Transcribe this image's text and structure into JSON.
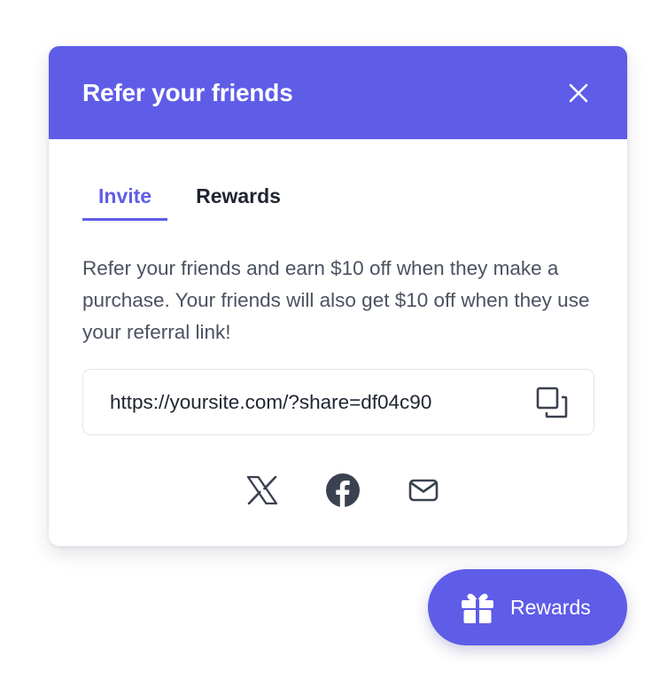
{
  "colors": {
    "accent": "#5f5ce8",
    "text_dark": "#1f2430",
    "text_body": "#4b5261",
    "icon_gray": "#3a4150",
    "border": "#e2e4ea"
  },
  "panel": {
    "title": "Refer your friends",
    "close_icon": "close-icon"
  },
  "tabs": [
    {
      "label": "Invite",
      "active": true
    },
    {
      "label": "Rewards",
      "active": false
    }
  ],
  "invite": {
    "description": "Refer your friends and earn $10 off when they make a purchase. Your friends will also get $10 off when they use your referral link!",
    "referral_link": "https://yoursite.com/?share=df04c90",
    "copy_icon": "copy-icon",
    "share_icons": [
      "x-twitter-icon",
      "facebook-icon",
      "mail-icon"
    ]
  },
  "launcher": {
    "label": "Rewards",
    "icon": "gift-icon"
  }
}
